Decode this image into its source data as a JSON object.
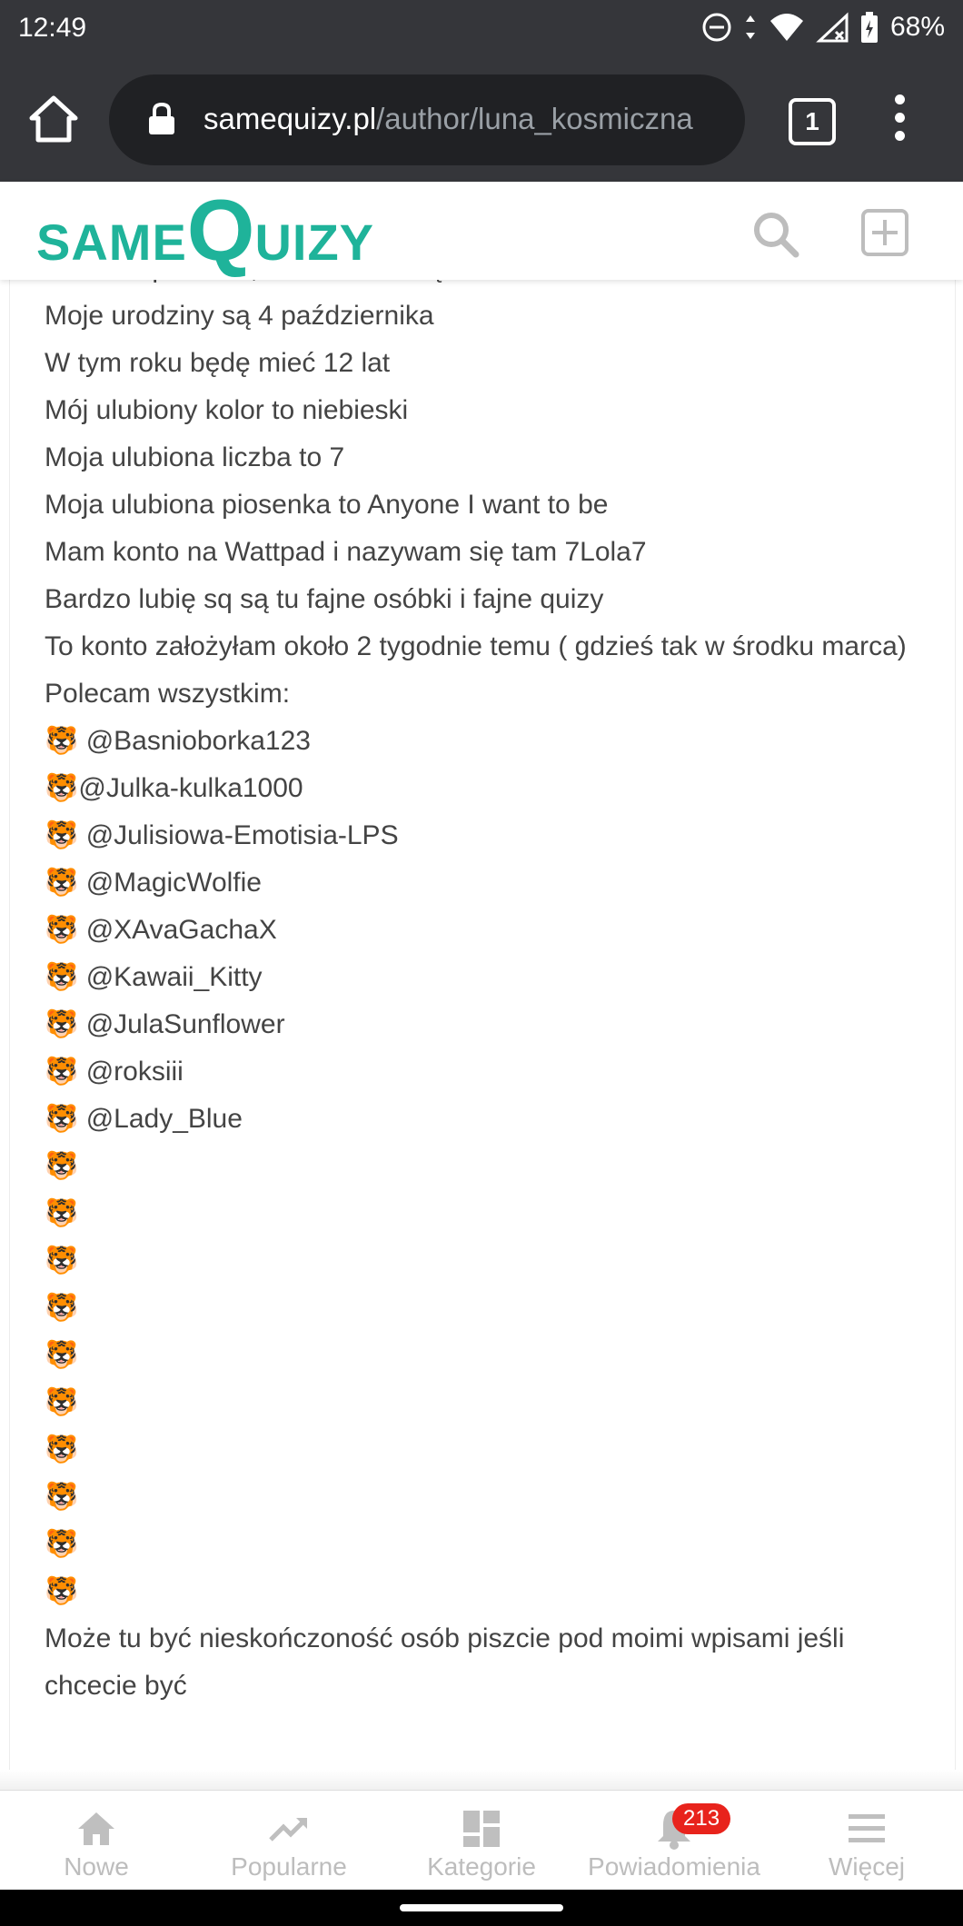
{
  "status_bar": {
    "time": "12:49",
    "battery": "68%",
    "icons": [
      "do-not-disturb-icon",
      "data-arrows-icon",
      "wifi-icon",
      "signal-icon",
      "battery-icon"
    ]
  },
  "browser": {
    "url_domain": "samequizy.pl",
    "url_path": "/author/luna_kosmiczna",
    "tab_count": "1"
  },
  "site": {
    "logo_small_1": "SAME",
    "logo_big": "Q",
    "logo_small_2": "UIZY",
    "brand_color": "#1fb39a"
  },
  "content": {
    "cut_line": "Kocham podróże, kosmos i wodę",
    "lines": [
      "Moje urodziny są 4 października",
      "W tym roku będę mieć 12 lat",
      "Mój ulubiony kolor to niebieski",
      "Moja ulubiona liczba to 7",
      "Moja ulubiona piosenka to Anyone I want to be",
      "Mam konto na Wattpad i nazywam się tam 7Lola7",
      "Bardzo lubię sq są tu fajne osóbki i fajne quizy",
      "To konto założyłam około 2 tygodnie temu ( gdzieś tak w środku marca)",
      "Polecam wszystkim:"
    ],
    "tiger": "🐯",
    "mentions": [
      " @Basnioborka123",
      "@Julka-kulka1000",
      " @Julisiowa-Emotisia-LPS",
      " @MagicWolfie",
      " @XAvaGachaX",
      " @Kawaii_Kitty",
      " @JulaSunflower",
      " @roksiii",
      " @Lady_Blue",
      "",
      "",
      "",
      "",
      "",
      "",
      "",
      "",
      "",
      ""
    ],
    "closing": "Może tu być nieskończoność osób piszcie pod moimi wpisami jeśli chcecie być"
  },
  "nav": {
    "items": [
      {
        "label": "Nowe",
        "icon": "home-icon"
      },
      {
        "label": "Popularne",
        "icon": "trending-icon"
      },
      {
        "label": "Kategorie",
        "icon": "dashboard-icon"
      },
      {
        "label": "Powiadomienia",
        "icon": "bell-icon",
        "badge": "213"
      },
      {
        "label": "Więcej",
        "icon": "menu-icon"
      }
    ]
  }
}
